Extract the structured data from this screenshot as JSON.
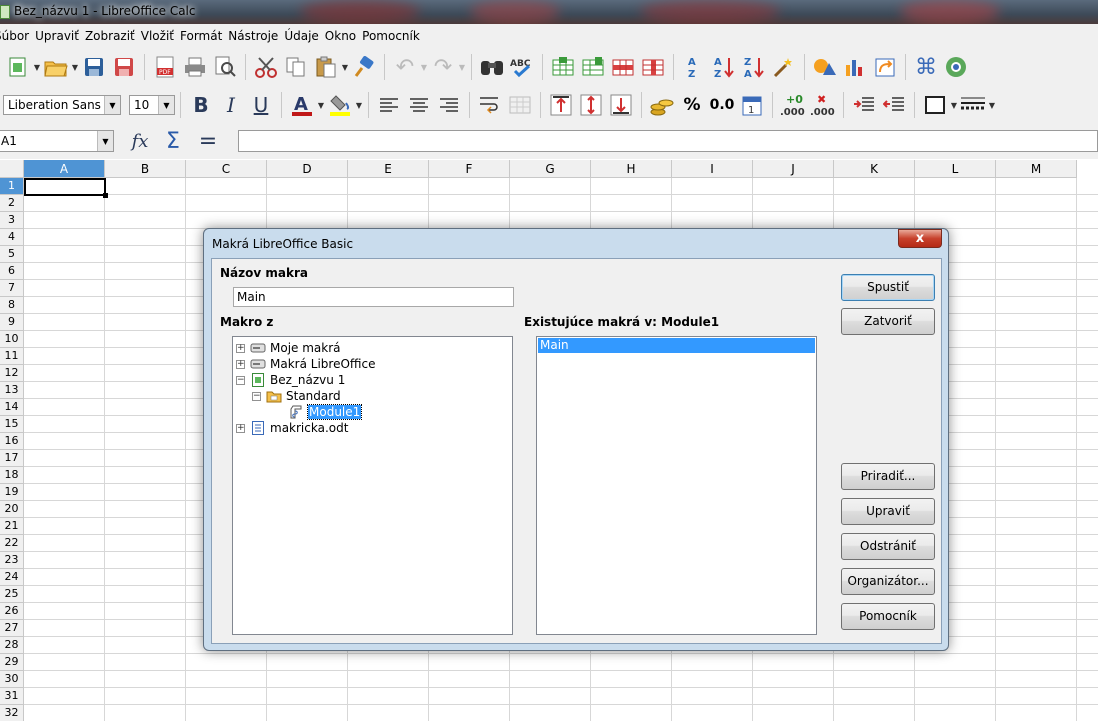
{
  "window": {
    "title": "Bez_názvu 1 - LibreOffice Calc"
  },
  "menu": [
    "Súbor",
    "Upraviť",
    "Zobraziť",
    "Vložiť",
    "Formát",
    "Nástroje",
    "Údaje",
    "Okno",
    "Pomocník"
  ],
  "formatting": {
    "font_name": "Liberation Sans",
    "font_size": "10",
    "percent_label": "%",
    "number_label": "0.0"
  },
  "formula": {
    "name_box": "A1",
    "fx_label": "fx",
    "sum_label": "Σ",
    "eq_label": "="
  },
  "sheet": {
    "columns": [
      "A",
      "B",
      "C",
      "D",
      "E",
      "F",
      "G",
      "H",
      "I",
      "J",
      "K",
      "L",
      "M"
    ],
    "rows": [
      "1",
      "2",
      "3",
      "4",
      "5",
      "6",
      "7",
      "8",
      "9",
      "10",
      "11",
      "12",
      "13",
      "14",
      "15",
      "16",
      "17",
      "18",
      "19",
      "20",
      "21",
      "22",
      "23",
      "24",
      "25",
      "26",
      "27",
      "28",
      "29",
      "30",
      "31",
      "32"
    ],
    "selected_cell": "A1"
  },
  "dialog": {
    "title": "Makrá LibreOffice Basic",
    "close_label": "x",
    "macro_name_label": "Názov makra",
    "macro_name_value": "Main",
    "macro_from_label": "Makro z",
    "existing_label": "Existujúce makrá v: Module1",
    "tree": [
      {
        "label": "Moje makrá"
      },
      {
        "label": "Makrá LibreOffice"
      },
      {
        "label": "Bez_názvu 1"
      },
      {
        "label": "Standard"
      },
      {
        "label": "Module1"
      },
      {
        "label": "makricka.odt"
      }
    ],
    "macros": [
      "Main"
    ],
    "buttons": {
      "run": "Spustiť",
      "close": "Zatvoriť",
      "assign": "Priradiť...",
      "edit": "Upraviť",
      "delete": "Odstrániť",
      "organizer": "Organizátor...",
      "help": "Pomocník"
    }
  }
}
